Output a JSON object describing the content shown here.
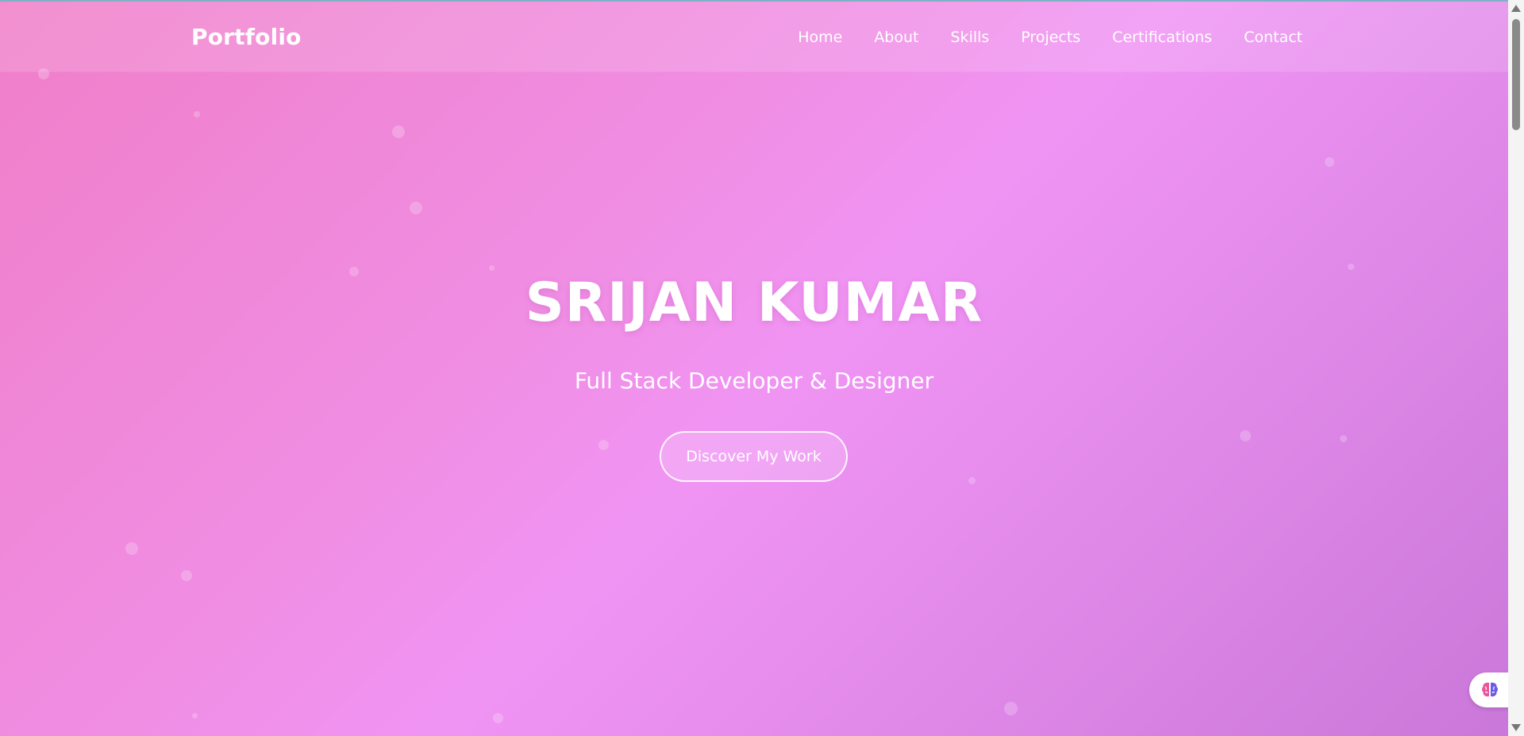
{
  "brand": "Portfolio",
  "nav": {
    "items": [
      {
        "label": "Home"
      },
      {
        "label": "About"
      },
      {
        "label": "Skills"
      },
      {
        "label": "Projects"
      },
      {
        "label": "Certifications"
      },
      {
        "label": "Contact"
      }
    ]
  },
  "hero": {
    "title": "SRIJAN KUMAR",
    "subtitle": "Full Stack Developer & Designer",
    "cta_label": "Discover My Work"
  },
  "floating_button": {
    "icon": "brain-icon"
  },
  "colors": {
    "gradient_start": "#f07ec8",
    "gradient_mid": "#f094f4",
    "gradient_end": "#c977d9",
    "text": "#ffffff"
  }
}
